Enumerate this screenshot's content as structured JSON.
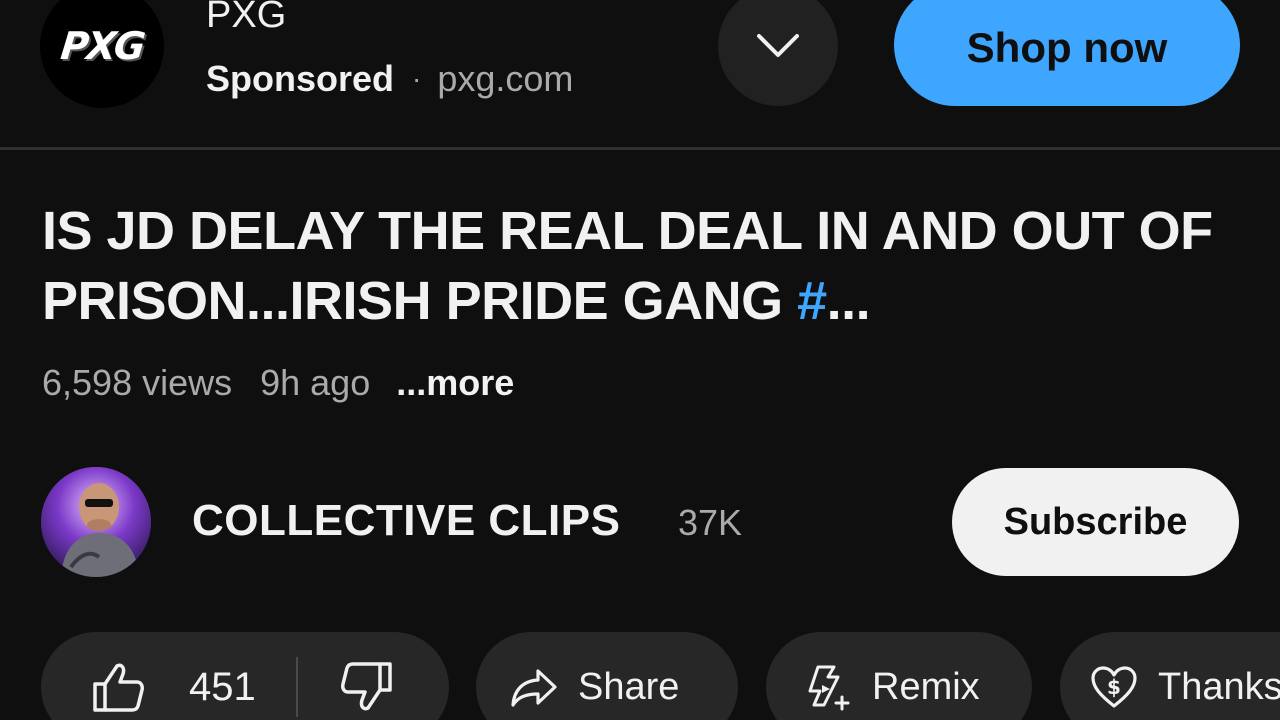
{
  "ad": {
    "logo_text": "PXG",
    "advertiser_name": "PXG",
    "sponsored_label": "Sponsored",
    "separator": "·",
    "domain": "pxg.com",
    "cta_label": "Shop now"
  },
  "video": {
    "title_text": "IS JD DELAY THE REAL DEAL IN AND OUT OF PRISON...IRISH PRIDE GANG ",
    "hashtag": "#",
    "title_ellipsis": "...",
    "views": "6,598 views",
    "age": "9h ago",
    "more_label": "...more"
  },
  "channel": {
    "name": "COLLECTIVE CLIPS",
    "subscriber_count": "37K",
    "subscribe_label": "Subscribe"
  },
  "actions": {
    "like_count": "451",
    "share_label": "Share",
    "remix_label": "Remix",
    "thanks_label": "Thanks"
  },
  "colors": {
    "background": "#0f0f0f",
    "accent_blue": "#3ea6ff",
    "pill_bg": "#272727"
  },
  "icons": [
    "chevron-down-icon",
    "thumbs-up-icon",
    "thumbs-down-icon",
    "share-arrow-icon",
    "remix-icon",
    "thanks-heart-dollar-icon"
  ]
}
